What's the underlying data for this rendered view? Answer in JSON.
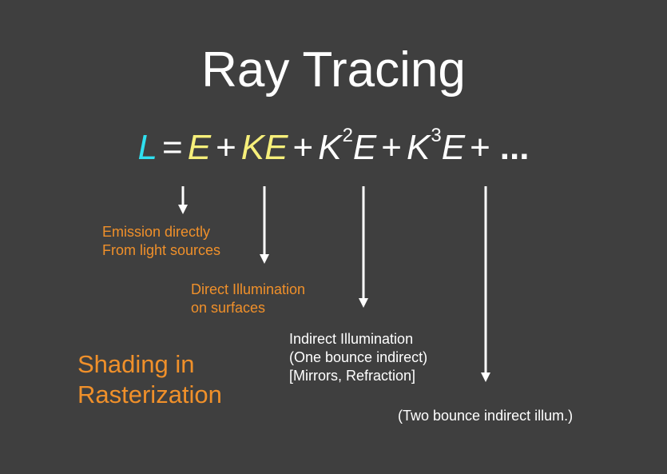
{
  "colors": {
    "background": "#3f3f3f",
    "white": "#ffffff",
    "cyan": "#2fe0f0",
    "yellow": "#f6ef7a",
    "orange": "#f0902a"
  },
  "title": "Ray Tracing",
  "equation": {
    "lhs": "L",
    "equals": "=",
    "t1": "E",
    "plus1": "+",
    "t2": "KE",
    "plus2": "+",
    "t3_base": "K",
    "t3_exp": "2",
    "t3_tail": "E",
    "plus3": "+",
    "t4_base": "K",
    "t4_exp": "3",
    "t4_tail": "E",
    "plus4": "+",
    "ellipsis": "..."
  },
  "labels": {
    "emission": [
      "Emission directly",
      "From light sources"
    ],
    "direct": [
      "Direct Illumination",
      "on surfaces"
    ],
    "indirect": [
      "Indirect Illumination",
      "(One bounce indirect)",
      "[Mirrors, Refraction]"
    ],
    "two_bounce": "(Two bounce indirect illum.)",
    "shading": [
      "Shading in",
      "Rasterization"
    ]
  }
}
